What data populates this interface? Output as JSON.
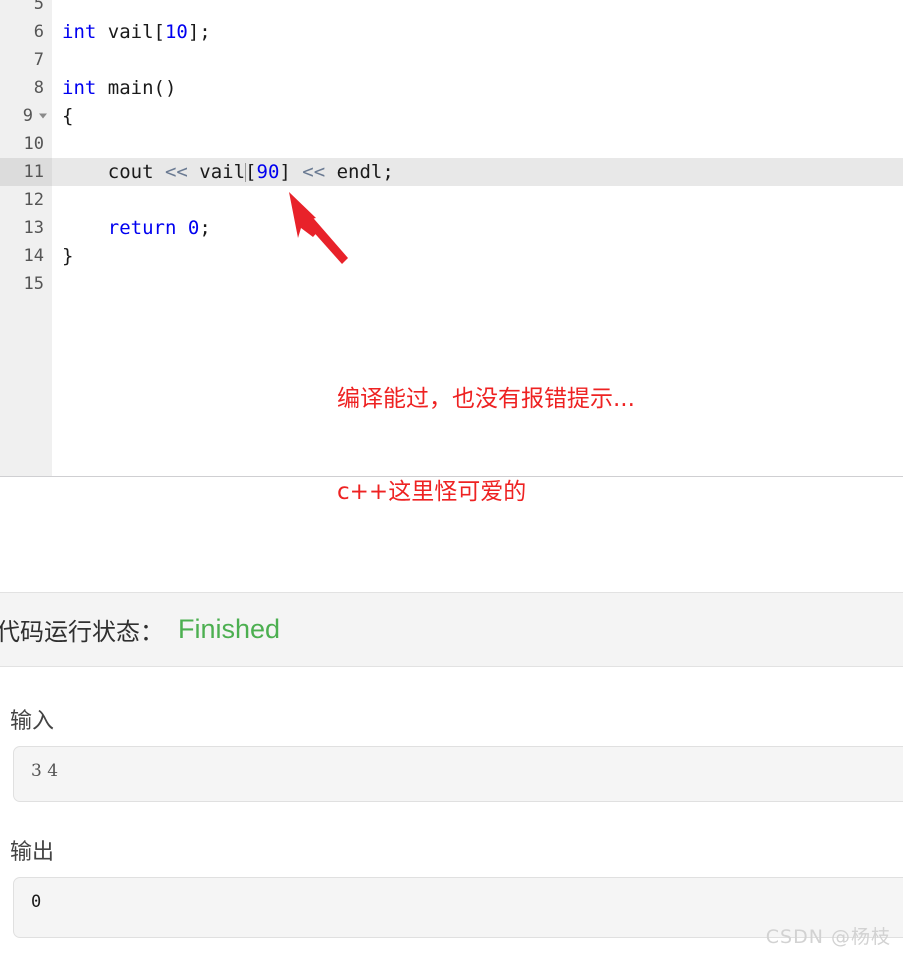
{
  "editor": {
    "active_line": 11,
    "caret_line": 11,
    "gutter_bg": "#f0f0f0",
    "active_row_bg": "#e8e8e8",
    "keyword_color": "#0000f0",
    "number_color": "#0000f0",
    "operator_color": "#6a7a92",
    "lines": [
      {
        "num": "5",
        "fold": false,
        "segments": []
      },
      {
        "num": "6",
        "fold": false,
        "segments": [
          {
            "t": "int",
            "c": "kw"
          },
          {
            "t": " vail[",
            "c": "pl"
          },
          {
            "t": "10",
            "c": "num"
          },
          {
            "t": "];",
            "c": "pl"
          }
        ]
      },
      {
        "num": "7",
        "fold": false,
        "segments": []
      },
      {
        "num": "8",
        "fold": false,
        "segments": [
          {
            "t": "int",
            "c": "kw"
          },
          {
            "t": " main()",
            "c": "pl"
          }
        ]
      },
      {
        "num": "9",
        "fold": true,
        "segments": [
          {
            "t": "{",
            "c": "pl"
          }
        ]
      },
      {
        "num": "10",
        "fold": false,
        "segments": []
      },
      {
        "num": "11",
        "fold": false,
        "segments": [
          {
            "t": "    cout ",
            "c": "pl"
          },
          {
            "t": "<<",
            "c": "op"
          },
          {
            "t": " vail",
            "c": "pl"
          },
          {
            "t": "|CARET|",
            "c": "caret"
          },
          {
            "t": "[",
            "c": "pl"
          },
          {
            "t": "90",
            "c": "num"
          },
          {
            "t": "] ",
            "c": "pl"
          },
          {
            "t": "<<",
            "c": "op"
          },
          {
            "t": " endl;",
            "c": "pl"
          }
        ]
      },
      {
        "num": "12",
        "fold": false,
        "segments": []
      },
      {
        "num": "13",
        "fold": false,
        "segments": [
          {
            "t": "    ",
            "c": "pl"
          },
          {
            "t": "return",
            "c": "kw"
          },
          {
            "t": " ",
            "c": "pl"
          },
          {
            "t": "0",
            "c": "num"
          },
          {
            "t": ";",
            "c": "pl"
          }
        ]
      },
      {
        "num": "14",
        "fold": false,
        "segments": [
          {
            "t": "}",
            "c": "pl"
          }
        ]
      },
      {
        "num": "15",
        "fold": false,
        "segments": []
      }
    ]
  },
  "annotation": {
    "color": "#ee2222",
    "line1": "编译能过，也没有报错提示...",
    "line2": "c++这里怪可爱的",
    "arrow_color": "#e8222a"
  },
  "status": {
    "label": "代码运行状态：",
    "value": "Finished",
    "value_color": "#4caf50"
  },
  "input_section": {
    "label": "输入",
    "value": "3 4"
  },
  "output_section": {
    "label": "输出",
    "value": "0"
  },
  "watermark": {
    "text": "CSDN @杨枝"
  }
}
